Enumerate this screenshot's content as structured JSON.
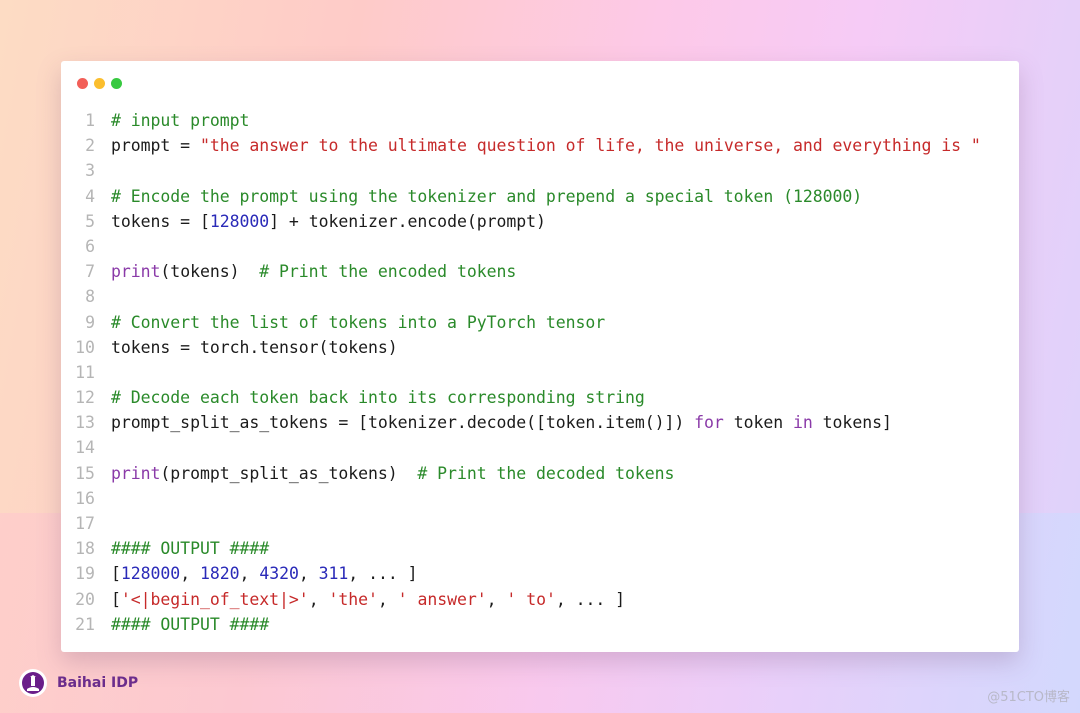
{
  "window": {
    "traffic_lights": [
      {
        "name": "close",
        "color": "#f25f58"
      },
      {
        "name": "minimize",
        "color": "#fbbe2e"
      },
      {
        "name": "maximize",
        "color": "#37c940"
      }
    ]
  },
  "code": {
    "lines": [
      {
        "n": "1",
        "tokens": [
          {
            "t": "cm",
            "v": "# input prompt"
          }
        ]
      },
      {
        "n": "2",
        "tokens": [
          {
            "t": "plain",
            "v": "prompt = "
          },
          {
            "t": "str",
            "v": "\"the answer to the ultimate question of life, the universe, and everything is \""
          }
        ]
      },
      {
        "n": "3",
        "tokens": []
      },
      {
        "n": "4",
        "tokens": [
          {
            "t": "cm",
            "v": "# Encode the prompt using the tokenizer and prepend a special token (128000)"
          }
        ]
      },
      {
        "n": "5",
        "tokens": [
          {
            "t": "plain",
            "v": "tokens = ["
          },
          {
            "t": "num",
            "v": "128000"
          },
          {
            "t": "plain",
            "v": "] + tokenizer.encode(prompt)"
          }
        ]
      },
      {
        "n": "6",
        "tokens": []
      },
      {
        "n": "7",
        "tokens": [
          {
            "t": "kw",
            "v": "print"
          },
          {
            "t": "plain",
            "v": "(tokens)  "
          },
          {
            "t": "cm",
            "v": "# Print the encoded tokens"
          }
        ]
      },
      {
        "n": "8",
        "tokens": []
      },
      {
        "n": "9",
        "tokens": [
          {
            "t": "cm",
            "v": "# Convert the list of tokens into a PyTorch tensor"
          }
        ]
      },
      {
        "n": "10",
        "tokens": [
          {
            "t": "plain",
            "v": "tokens = torch.tensor(tokens)"
          }
        ]
      },
      {
        "n": "11",
        "tokens": []
      },
      {
        "n": "12",
        "tokens": [
          {
            "t": "cm",
            "v": "# Decode each token back into its corresponding string"
          }
        ]
      },
      {
        "n": "13",
        "tokens": [
          {
            "t": "plain",
            "v": "prompt_split_as_tokens = [tokenizer.decode([token.item()]) "
          },
          {
            "t": "kw",
            "v": "for"
          },
          {
            "t": "plain",
            "v": " token "
          },
          {
            "t": "kw",
            "v": "in"
          },
          {
            "t": "plain",
            "v": " tokens]"
          }
        ]
      },
      {
        "n": "14",
        "tokens": []
      },
      {
        "n": "15",
        "tokens": [
          {
            "t": "kw",
            "v": "print"
          },
          {
            "t": "plain",
            "v": "(prompt_split_as_tokens)  "
          },
          {
            "t": "cm",
            "v": "# Print the decoded tokens"
          }
        ]
      },
      {
        "n": "16",
        "tokens": []
      },
      {
        "n": "17",
        "tokens": []
      },
      {
        "n": "18",
        "tokens": [
          {
            "t": "cm",
            "v": "#### OUTPUT ####"
          }
        ]
      },
      {
        "n": "19",
        "tokens": [
          {
            "t": "plain",
            "v": "["
          },
          {
            "t": "num",
            "v": "128000"
          },
          {
            "t": "plain",
            "v": ", "
          },
          {
            "t": "num",
            "v": "1820"
          },
          {
            "t": "plain",
            "v": ", "
          },
          {
            "t": "num",
            "v": "4320"
          },
          {
            "t": "plain",
            "v": ", "
          },
          {
            "t": "num",
            "v": "311"
          },
          {
            "t": "plain",
            "v": ", ... ]"
          }
        ]
      },
      {
        "n": "20",
        "tokens": [
          {
            "t": "plain",
            "v": "["
          },
          {
            "t": "str",
            "v": "'<|begin_of_text|>'"
          },
          {
            "t": "plain",
            "v": ", "
          },
          {
            "t": "str",
            "v": "'the'"
          },
          {
            "t": "plain",
            "v": ", "
          },
          {
            "t": "str",
            "v": "' answer'"
          },
          {
            "t": "plain",
            "v": ", "
          },
          {
            "t": "str",
            "v": "' to'"
          },
          {
            "t": "plain",
            "v": ", ... ]"
          }
        ]
      },
      {
        "n": "21",
        "tokens": [
          {
            "t": "cm",
            "v": "#### OUTPUT ####"
          }
        ]
      }
    ]
  },
  "brand": {
    "name": "Baihai IDP",
    "logo_icon": "lighthouse-icon"
  },
  "watermark": "@51CTO博客"
}
